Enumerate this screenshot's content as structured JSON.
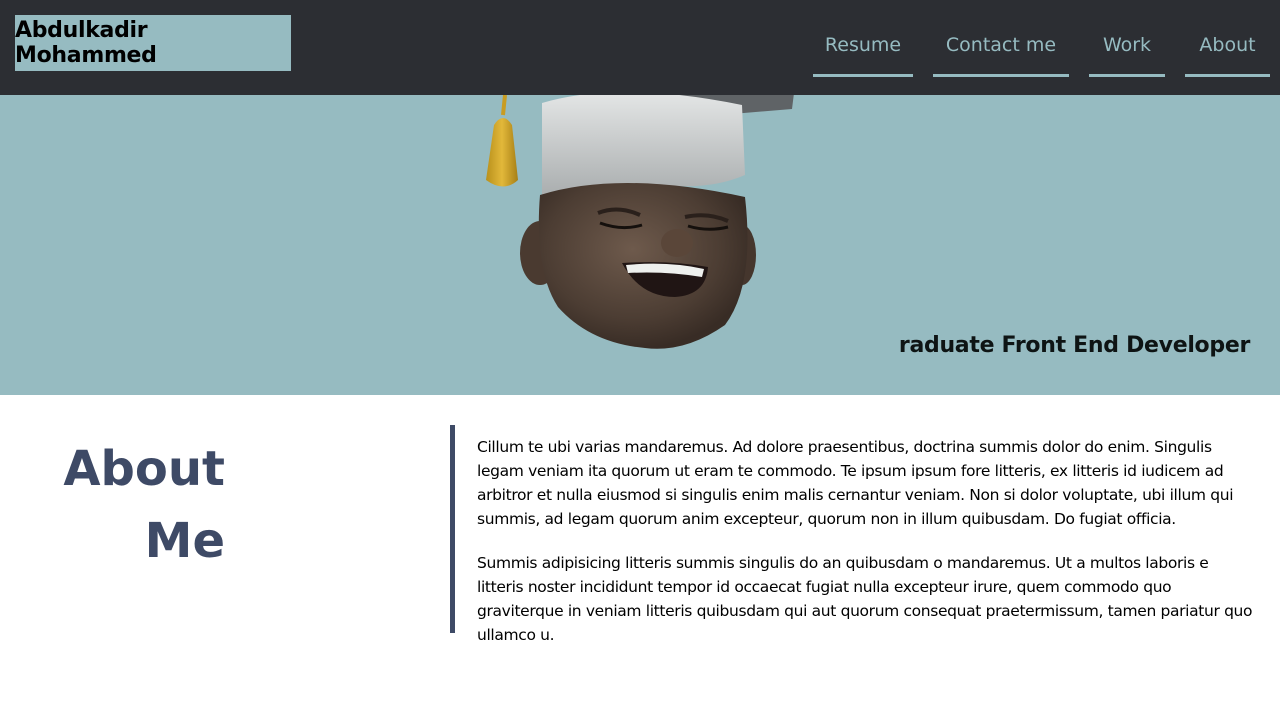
{
  "header": {
    "brand": "Abdulkadir Mohammed",
    "nav": [
      {
        "label": "Resume"
      },
      {
        "label": "Contact me"
      },
      {
        "label": "Work"
      },
      {
        "label": "About"
      }
    ]
  },
  "hero": {
    "image": "graduate-avatar-image",
    "tagline": "raduate Front End Developer"
  },
  "about": {
    "heading_line1": "About",
    "heading_line2": "Me",
    "paragraphs": [
      "Cillum te ubi varias mandaremus. Ad dolore praesentibus, doctrina summis dolor do enim. Singulis legam veniam ita quorum ut eram te commodo. Te ipsum ipsum fore litteris, ex litteris id iudicem ad arbitror et nulla eiusmod si singulis enim malis cernantur veniam. Non si dolor voluptate, ubi illum qui summis, ad legam quorum anim excepteur, quorum non in illum quibusdam. Do fugiat officia.",
      "Summis adipisicing litteris summis singulis do an quibusdam o mandaremus. Ut a multos laboris e litteris noster incididunt tempor id occaecat fugiat nulla excepteur irure, quem commodo quo graviterque in veniam litteris quibusdam qui aut quorum consequat praetermissum, tamen pariatur quo ullamco u."
    ]
  },
  "colors": {
    "navbar_bg": "#2c2e33",
    "accent": "#96bbc1",
    "heading": "#3e4a66"
  }
}
